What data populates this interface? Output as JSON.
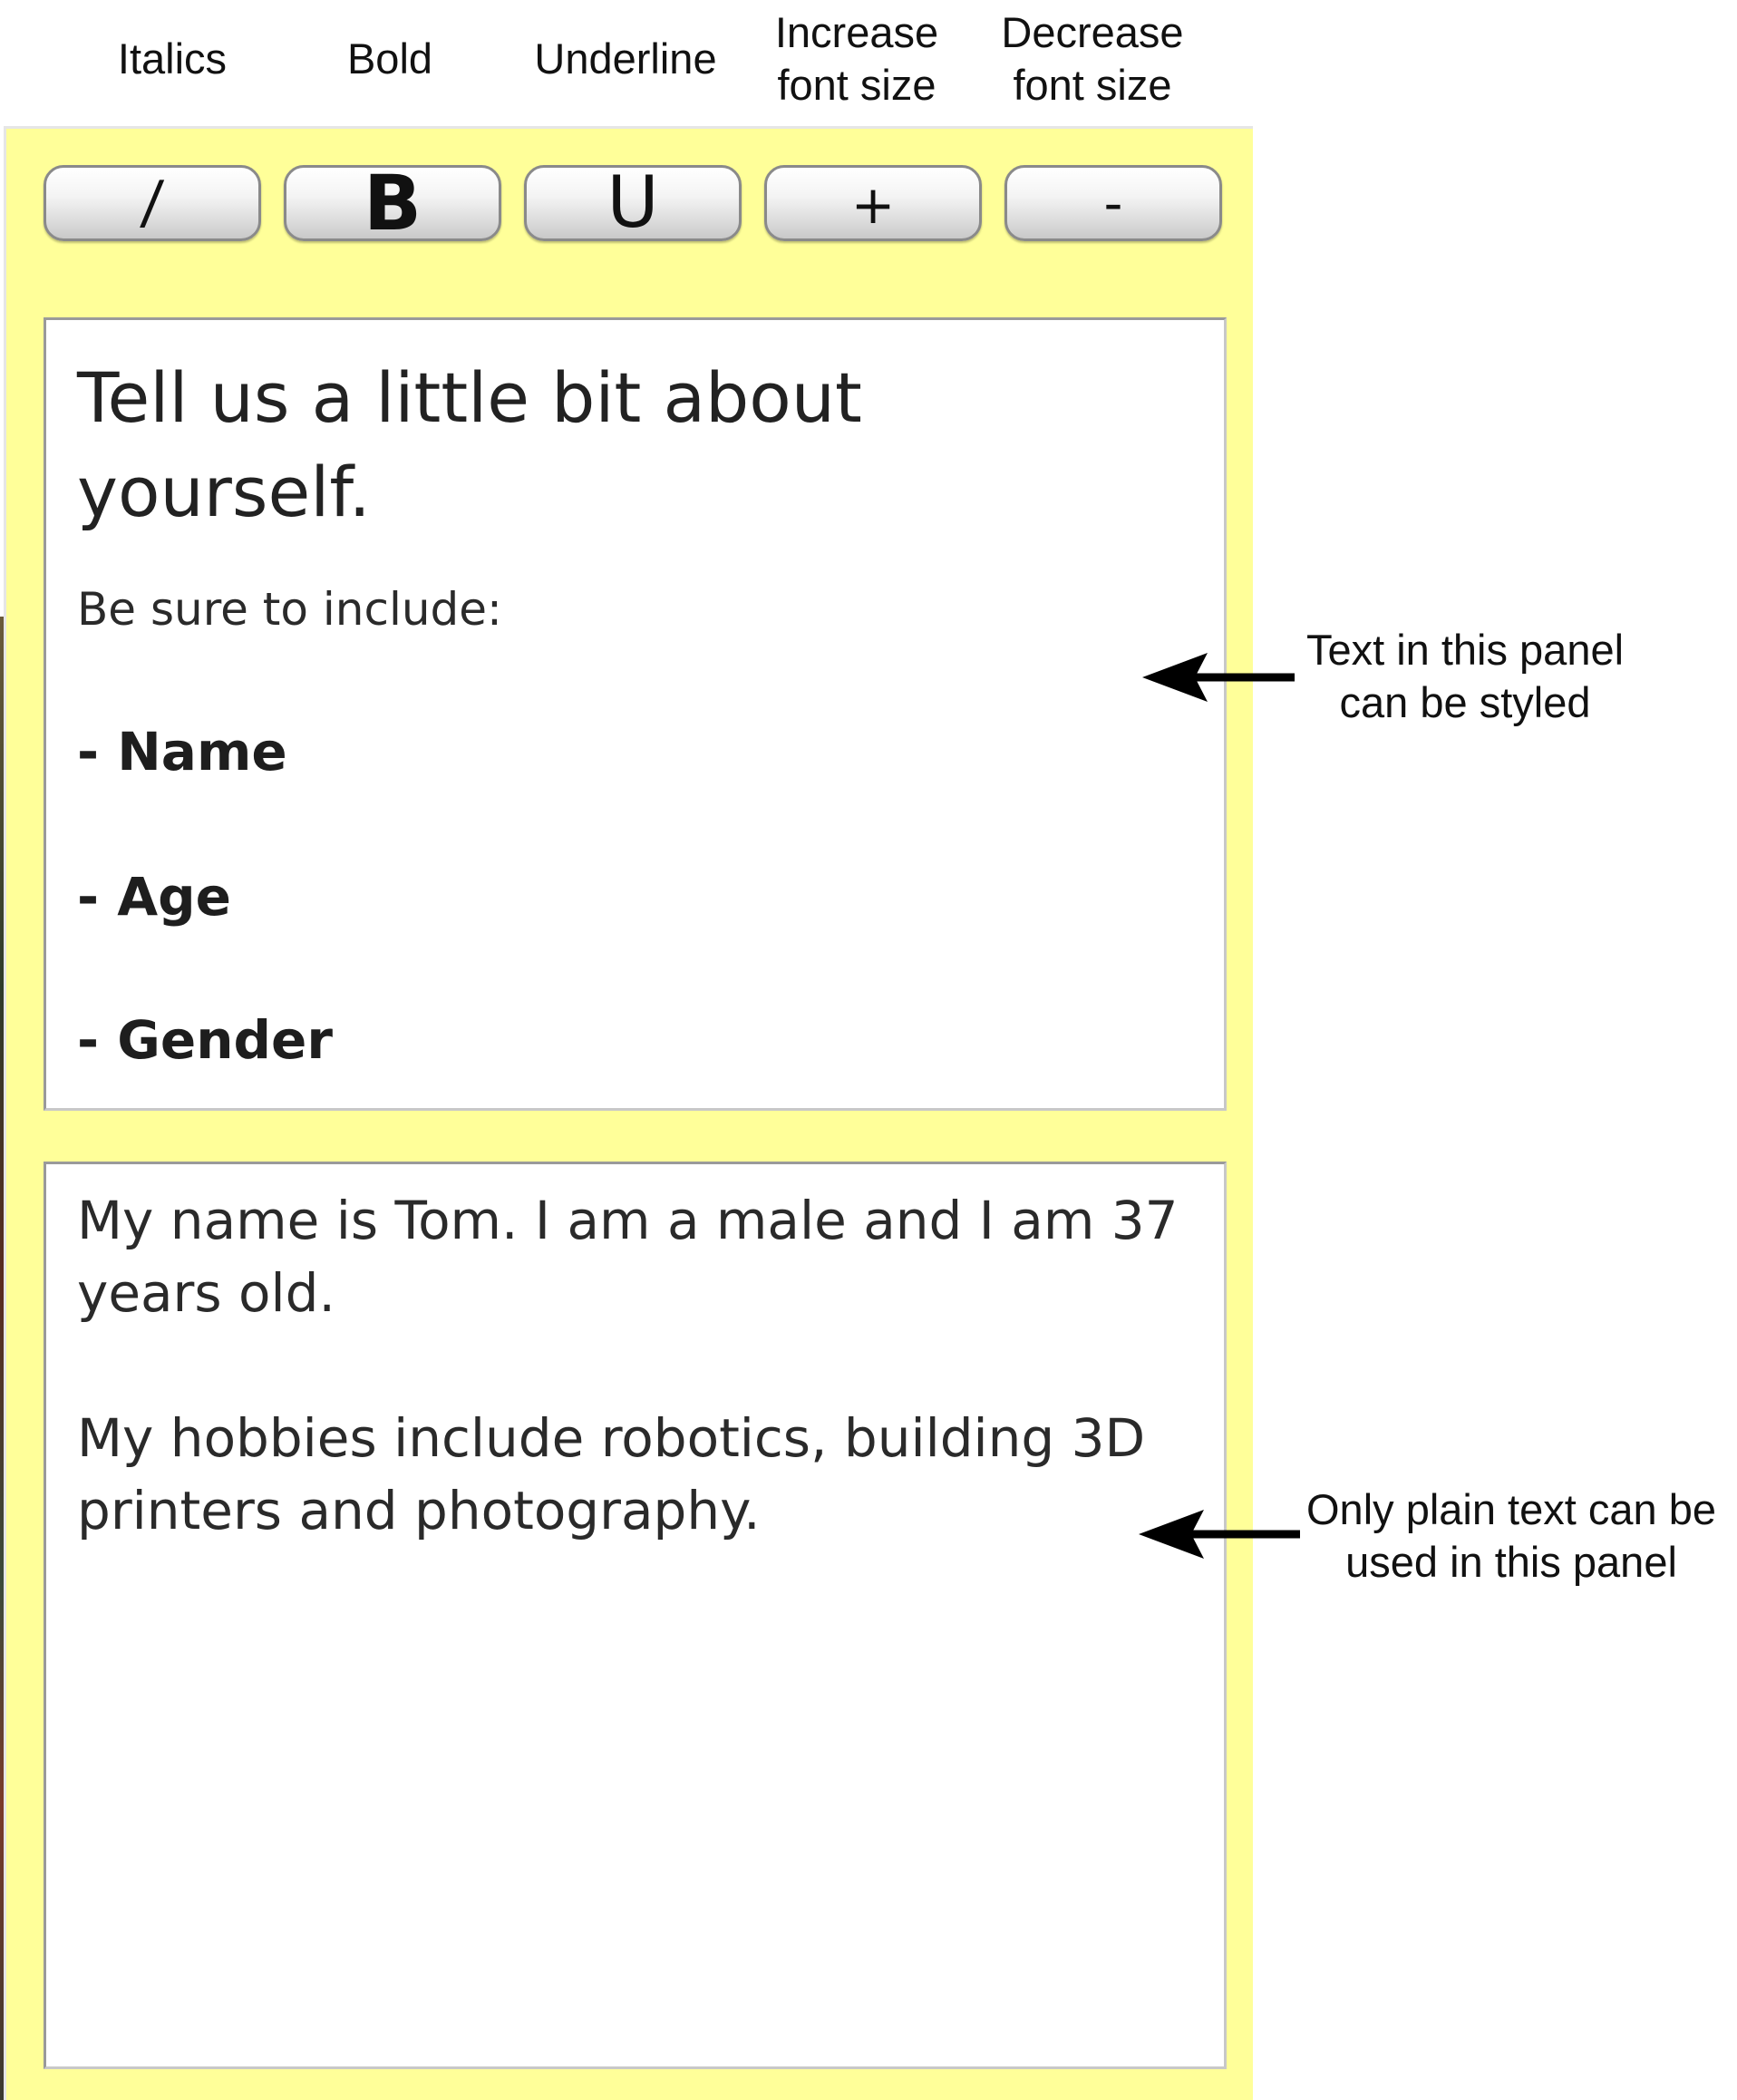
{
  "toolbar_labels": {
    "italics": "Italics",
    "bold": "Bold",
    "underline": "Underline",
    "increase": "Increase\nfont size",
    "decrease": "Decrease\nfont size"
  },
  "toolbar": {
    "italic_btn": "/",
    "bold_btn": "B",
    "underline_btn": "U",
    "increase_btn": "+",
    "decrease_btn": "-"
  },
  "styled_panel": {
    "heading": "Tell us a little bit about yourself.",
    "subheading": "Be sure to include:",
    "items": [
      "- Name",
      "- Age",
      "- Gender"
    ]
  },
  "plain_panel": {
    "paragraphs": [
      "My name is Tom. I am a male and I am 37 years old.",
      "My hobbies include robotics, building 3D printers and photography."
    ]
  },
  "callouts": {
    "styled": "Text in this panel\ncan be styled",
    "plain": "Only plain text can be\nused in this panel"
  },
  "colors": {
    "panel_background": "#ffff99",
    "text_area_background": "#ffffff"
  }
}
